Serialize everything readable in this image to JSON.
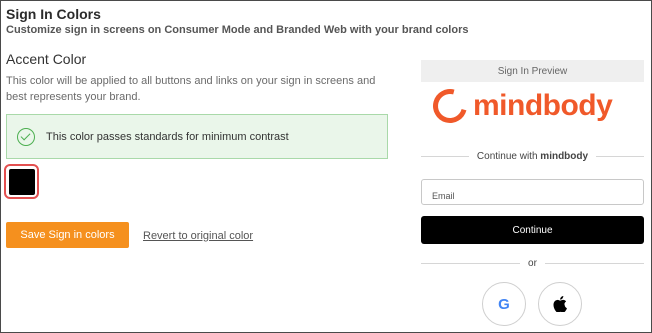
{
  "header": {
    "title": "Sign In Colors",
    "subtitle": "Customize sign in screens on Consumer Mode and Branded Web with your brand colors"
  },
  "accent": {
    "title": "Accent Color",
    "description": "This color will be applied to all buttons and links on your sign in screens and best represents your brand.",
    "contrast_message": "This color passes standards for minimum contrast",
    "current_color": "#000000"
  },
  "actions": {
    "save_label": "Save Sign in colors",
    "revert_label": "Revert to original color"
  },
  "preview": {
    "header": "Sign In Preview",
    "logo_text": "mindbody",
    "continue_with_prefix": "Continue with",
    "continue_with_brand": "mindbody",
    "email_placeholder": "Email",
    "continue_label": "Continue",
    "or_label": "or",
    "google_glyph": "G",
    "apple_glyph": ""
  },
  "colors": {
    "brand_orange": "#f0592a",
    "save_button": "#f5901e",
    "success_border": "#a9d9a9",
    "success_bg": "#eaf6ea",
    "swatch_highlight": "#e35050"
  }
}
